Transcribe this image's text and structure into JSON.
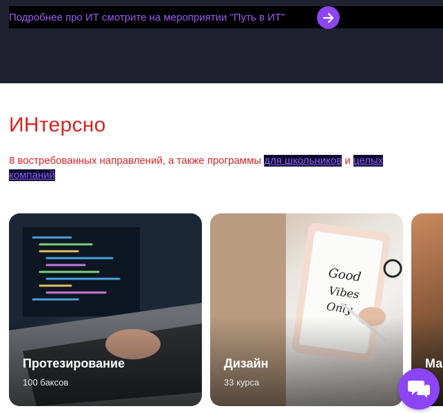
{
  "banner": {
    "text": "Подробнее про ИТ смотрите на мероприятии \"Путь в ИТ\"",
    "arrow_icon": "arrow-right-icon"
  },
  "section": {
    "title": "ИНтерсно",
    "subtitle_prefix": "8 востребованных направлений, а также программы ",
    "link_schoolkids": "для школьников",
    "conjunction": " и ",
    "link_companies": "целых компаний"
  },
  "cards": [
    {
      "title": "Протезирование",
      "meta": "100 баксов"
    },
    {
      "title": "Дизайн",
      "meta": "33 курса"
    },
    {
      "title": "Ма"
    }
  ],
  "chat": {
    "icon": "chat-bubbles-icon"
  },
  "colors": {
    "accent": "#8b45f5",
    "title_red": "#d92222",
    "banner_bg": "#1f2130"
  }
}
